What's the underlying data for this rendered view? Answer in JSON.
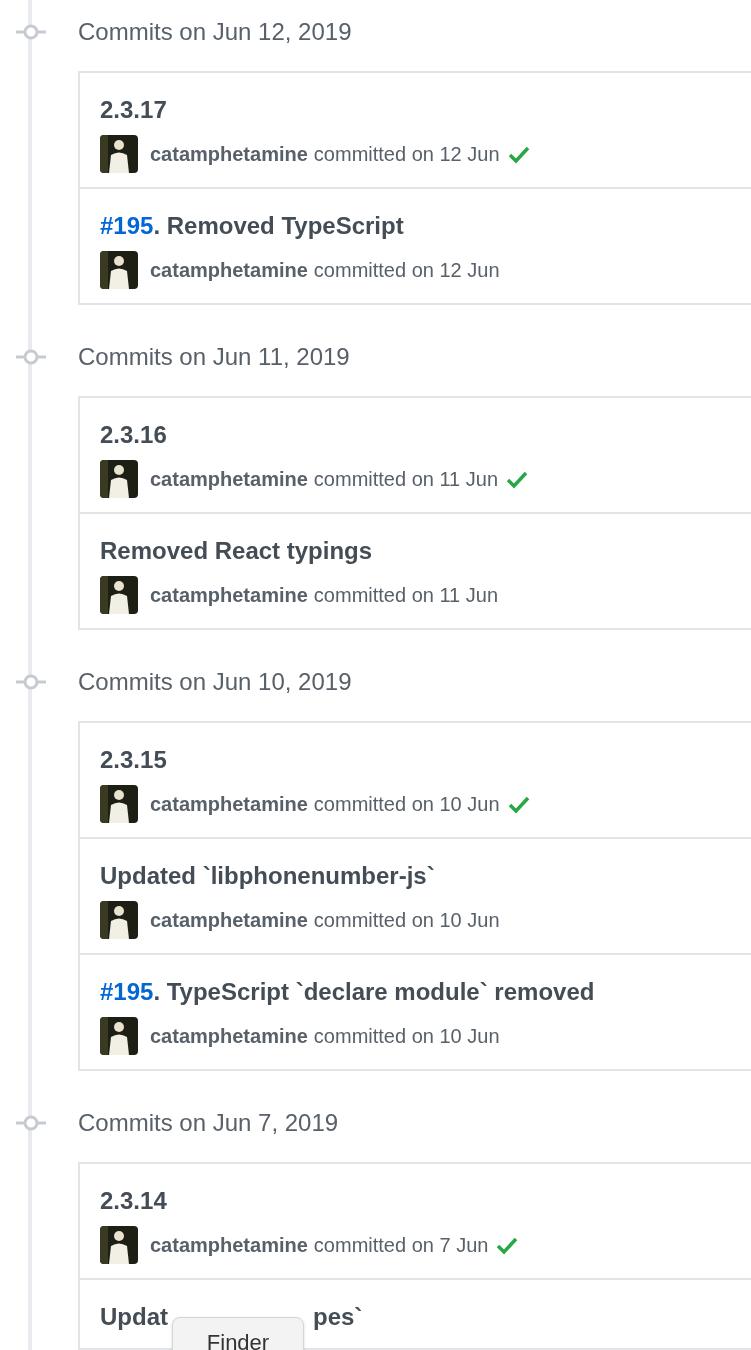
{
  "groups": [
    {
      "date": "Commits on Jun 12, 2019",
      "commits": [
        {
          "title": "2.3.17",
          "author": "catamphetamine",
          "when": "committed on 12 Jun",
          "verified": true
        },
        {
          "issue": "#195",
          "title": ". Removed TypeScript",
          "author": "catamphetamine",
          "when": "committed on 12 Jun",
          "verified": false
        }
      ]
    },
    {
      "date": "Commits on Jun 11, 2019",
      "commits": [
        {
          "title": "2.3.16",
          "author": "catamphetamine",
          "when": "committed on 11 Jun",
          "verified": true
        },
        {
          "title": "Removed React typings",
          "author": "catamphetamine",
          "when": "committed on 11 Jun",
          "verified": false
        }
      ]
    },
    {
      "date": "Commits on Jun 10, 2019",
      "commits": [
        {
          "title": "2.3.15",
          "author": "catamphetamine",
          "when": "committed on 10 Jun",
          "verified": true
        },
        {
          "title": "Updated `libphonenumber-js`",
          "author": "catamphetamine",
          "when": "committed on 10 Jun",
          "verified": false
        },
        {
          "issue": "#195",
          "title": ". TypeScript `declare module` removed",
          "author": "catamphetamine",
          "when": "committed on 10 Jun",
          "verified": false
        }
      ]
    },
    {
      "date": "Commits on Jun 7, 2019",
      "commits": [
        {
          "title": "2.3.14",
          "author": "catamphetamine",
          "when": "committed on 7 Jun",
          "verified": true
        },
        {
          "title": "Updat",
          "title_tail": "pes`"
        }
      ]
    }
  ],
  "tooltip": {
    "text": "Finder"
  }
}
